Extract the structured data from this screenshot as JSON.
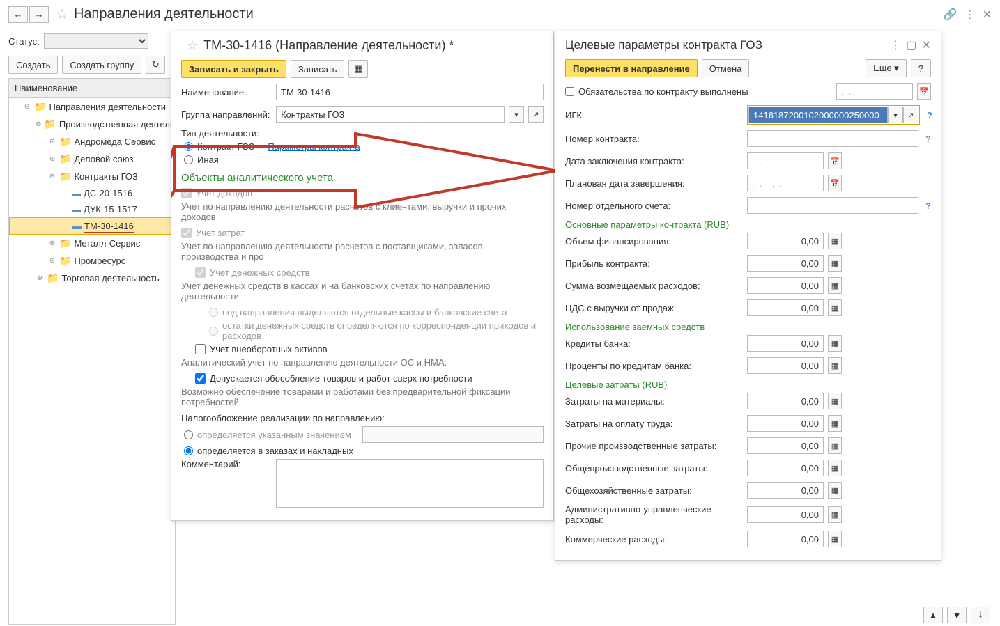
{
  "header": {
    "title": "Направления деятельности",
    "status_label": "Статус:"
  },
  "toolbar": {
    "create": "Создать",
    "create_group": "Создать группу"
  },
  "tree": {
    "header": "Наименование",
    "items": [
      {
        "label": "Направления деятельности",
        "level": 1,
        "folder": true,
        "expand": "⊖"
      },
      {
        "label": "Производственная деятель",
        "level": 2,
        "folder": true,
        "expand": "⊖"
      },
      {
        "label": "Андромеда Сервис",
        "level": 3,
        "folder": true,
        "expand": "⊕"
      },
      {
        "label": "Деловой союз",
        "level": 3,
        "folder": true,
        "expand": "⊕"
      },
      {
        "label": "Контракты ГОЗ",
        "level": 3,
        "folder": true,
        "expand": "⊖"
      },
      {
        "label": "ДС-20-1516",
        "level": 4,
        "folder": false
      },
      {
        "label": "ДУК-15-1517",
        "level": 4,
        "folder": false
      },
      {
        "label": "ТМ-30-1416",
        "level": 4,
        "folder": false,
        "selected": true
      },
      {
        "label": "Металл-Сервис",
        "level": 3,
        "folder": true,
        "expand": "⊕"
      },
      {
        "label": "Промресурс",
        "level": 3,
        "folder": true,
        "expand": "⊕"
      },
      {
        "label": "Торговая деятельность",
        "level": 2,
        "folder": true,
        "expand": "⊕"
      }
    ]
  },
  "form": {
    "title": "ТМ-30-1416 (Направление деятельности) *",
    "save_close": "Записать и закрыть",
    "save": "Записать",
    "name_label": "Наименование:",
    "name_value": "ТМ-30-1416",
    "group_label": "Группа направлений:",
    "group_value": "Контракты ГОЗ",
    "type_label": "Тип деятельности:",
    "type_goz": "Контракт ГОЗ",
    "type_other": "Иная",
    "contract_params_link": "Параметры контракта",
    "analytics_header": "Объекты аналитического учета",
    "income_check": "Учет доходов",
    "income_hint": "Учет по направлению деятельности расчетов с клиентами, выручки и прочих доходов.",
    "cost_check": "Учет затрат",
    "cost_hint": "Учет по направлению деятельности расчетов с поставщиками, запасов, производства и про",
    "money_check": "Учет денежных средств",
    "money_hint": "Учет денежных средств в кассах и на банковских счетах по направлению деятельности.",
    "money_opt1": "под направления выделяются отдельные кассы и банковские счета",
    "money_opt2": "остатки денежных средств определяются по корреспонденции приходов и расходов",
    "noncurrent_check": "Учет внеоборотных активов",
    "noncurrent_hint": "Аналитический учет по направлению деятельности ОС и НМА.",
    "surplus_check": "Допускается обособление товаров и работ сверх потребности",
    "surplus_hint": "Возможно обеспечение товарами и работами без предварительной фиксации потребностей",
    "tax_label": "Налогообложение реализации по направлению:",
    "tax_opt1": "определяется указанным значением",
    "tax_opt2": "определяется в заказах и накладных",
    "comment_label": "Комментарий:"
  },
  "right": {
    "title": "Целевые параметры контракта ГОЗ",
    "transfer": "Перенести в направление",
    "cancel": "Отмена",
    "more": "Еще",
    "help": "?",
    "obligations": "Обязательства по контракту выполнены",
    "igk_label": "ИГК:",
    "igk_value": "1416187200102000000250000",
    "contract_no": "Номер контракта:",
    "contract_date": "Дата заключения контракта:",
    "plan_date": "Плановая дата завершения:",
    "account_no": "Номер отдельного счета:",
    "main_params": "Основные параметры контракта (RUB)",
    "finance_volume": "Объем финансирования:",
    "profit": "Прибыль контракта:",
    "reimburse": "Сумма возмещаемых расходов:",
    "vat": "НДС с выручки от продаж:",
    "borrowed": "Использование заемных средств",
    "credits": "Кредиты банка:",
    "interest": "Проценты по кредитам банка:",
    "target_costs": "Целевые затраты (RUB)",
    "materials": "Затраты на материалы:",
    "labor": "Затраты на оплату труда:",
    "other_prod": "Прочие производственные затраты:",
    "overhead_prod": "Общепроизводственные затраты:",
    "overhead_gen": "Общехозяйственные затраты:",
    "admin": "Административно-управленческие расходы:",
    "commercial": "Коммерческие расходы:",
    "zero": "0,00",
    "date_placeholder": ".  .",
    "date_placeholder2": ".  .    ,  :"
  }
}
